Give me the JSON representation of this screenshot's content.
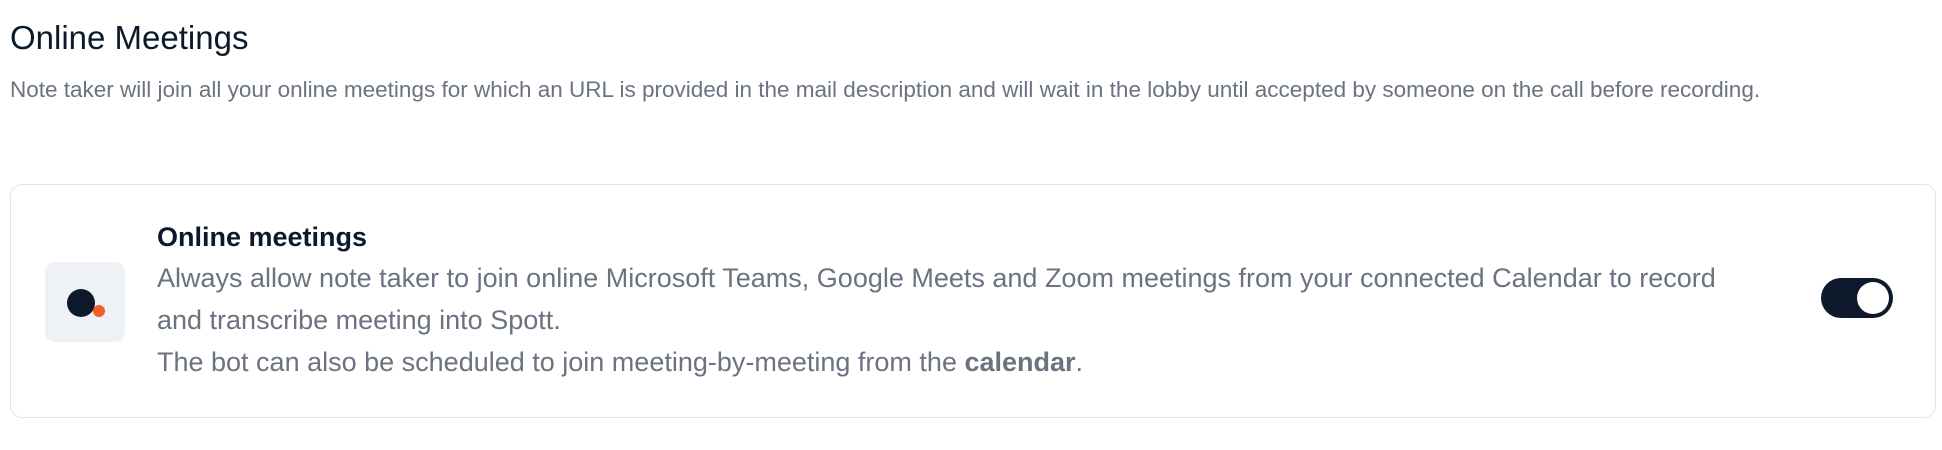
{
  "section": {
    "title": "Online Meetings",
    "description": "Note taker will join all your online meetings for which an URL is provided in the mail description and will wait in the lobby until accepted by someone on the call before recording."
  },
  "card": {
    "icon": "spott-logo-icon",
    "title": "Online meetings",
    "description_line1": "Always allow note taker to join online Microsoft Teams, Google Meets and Zoom meetings from your connected Calendar to record and transcribe meeting into Spott.",
    "description_line2_prefix": "The bot can also be scheduled to join meeting-by-meeting from the ",
    "description_line2_link": "calendar",
    "description_line2_suffix": ".",
    "toggle_on": true
  },
  "colors": {
    "accent": "#f0602a",
    "dark": "#0e1a2b",
    "muted_text": "#6b7280",
    "border": "#e2e4e9"
  }
}
